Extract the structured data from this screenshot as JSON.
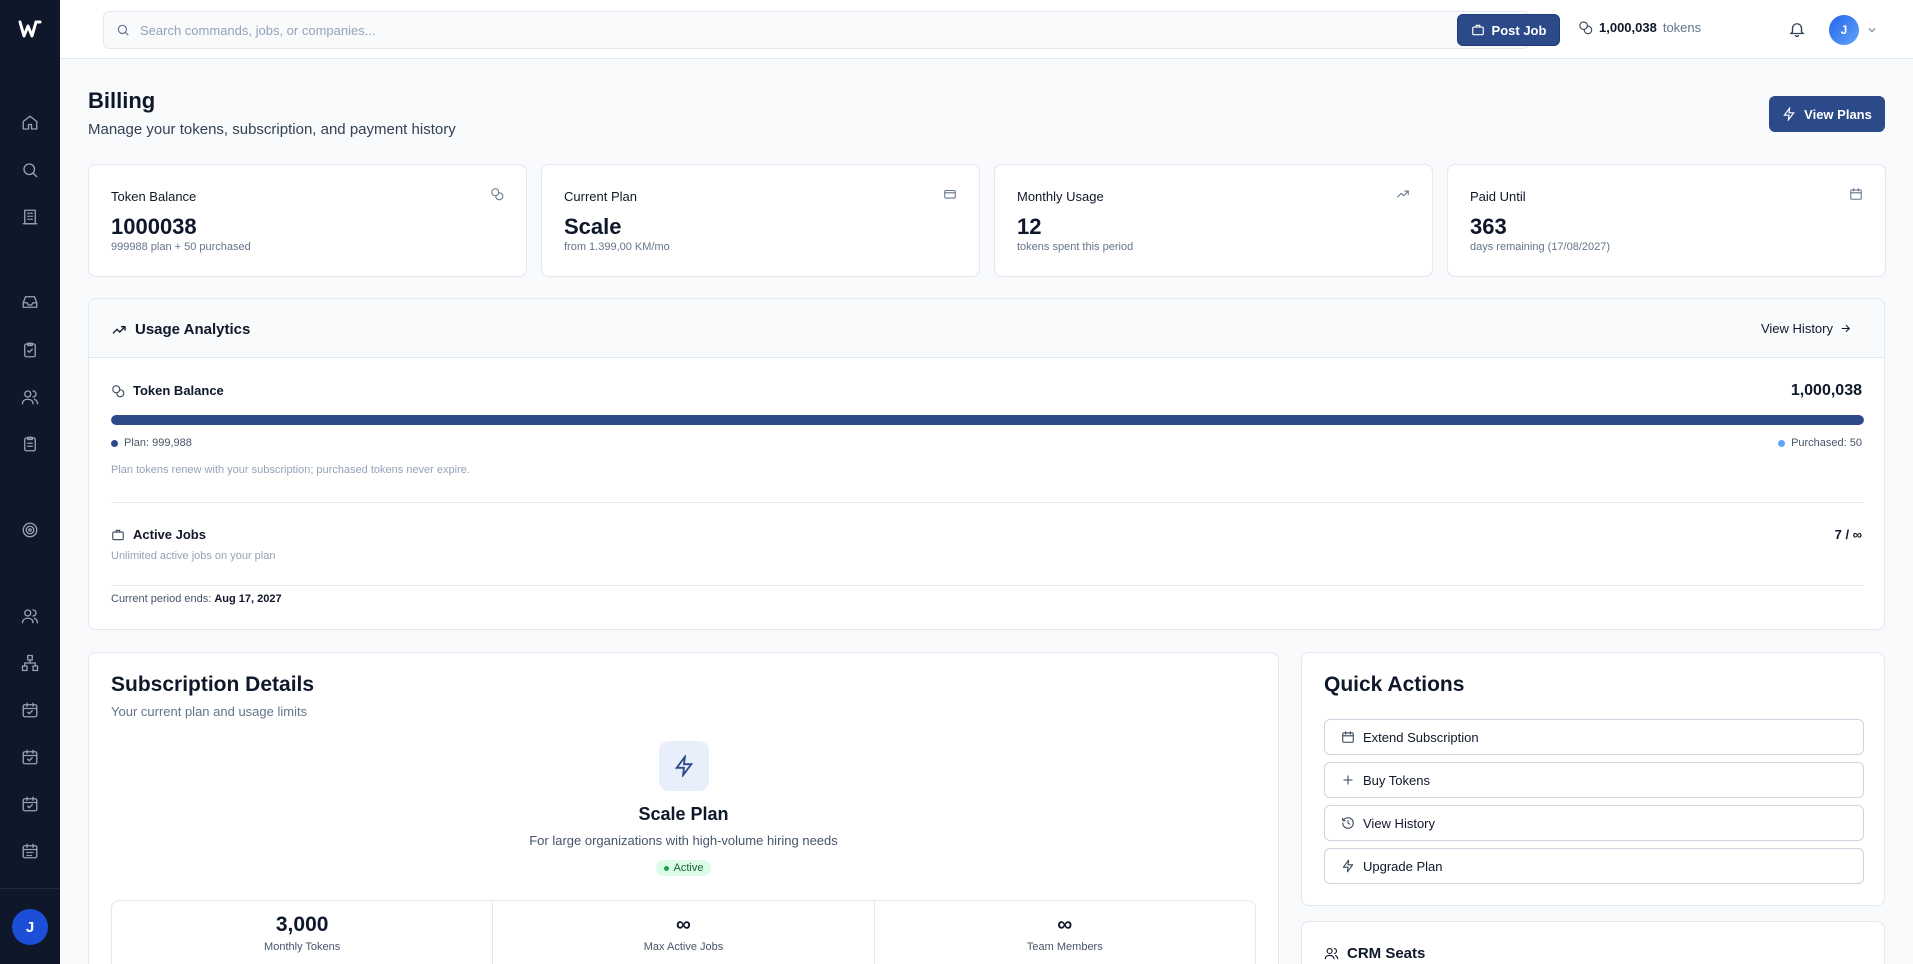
{
  "topbar": {
    "search_placeholder": "Search commands, jobs, or companies...",
    "post_job_label": "Post Job",
    "token_count": "1,000,038",
    "token_unit": "tokens",
    "avatar_initial": "J"
  },
  "sidebar": {
    "avatar_initial": "J",
    "icons": [
      "home-icon",
      "search-icon",
      "building-icon",
      "inbox-icon",
      "clipboard-check-icon",
      "users-icon",
      "clipboard-list-icon",
      "target-icon",
      "users-icon",
      "network-icon",
      "calendar-icon",
      "calendar-check-icon",
      "calendar-check-icon",
      "calendar-icon"
    ]
  },
  "header": {
    "title": "Billing",
    "subtitle": "Manage your tokens, subscription, and payment history",
    "view_plans_label": "View Plans"
  },
  "stats": [
    {
      "label": "Token Balance",
      "value": "1000038",
      "sub": "999988 plan + 50 purchased",
      "icon": "coins-icon"
    },
    {
      "label": "Current Plan",
      "value": "Scale",
      "sub": "from 1.399,00 KM/mo",
      "icon": "credit-card-icon"
    },
    {
      "label": "Monthly Usage",
      "value": "12",
      "sub": "tokens spent this period",
      "icon": "trending-up-icon"
    },
    {
      "label": "Paid Until",
      "value": "363",
      "sub": "days remaining (17/08/2027)",
      "icon": "calendar-icon"
    }
  ],
  "usage": {
    "title": "Usage Analytics",
    "view_history_label": "View History",
    "token_label": "Token Balance",
    "token_total": "1,000,038",
    "plan_fraction": 0.99995,
    "plan_legend": "Plan: 999,988",
    "purchased_legend": "Purchased: 50",
    "token_note": "Plan tokens renew with your subscription; purchased tokens never expire.",
    "jobs_label": "Active Jobs",
    "jobs_value": "7 / ∞",
    "jobs_note": "Unlimited active jobs on your plan",
    "period_label": "Current period ends:",
    "period_date": "Aug 17, 2027"
  },
  "subscription": {
    "title": "Subscription Details",
    "subtitle": "Your current plan and usage limits",
    "plan_name": "Scale Plan",
    "plan_desc": "For large organizations with high-volume hiring needs",
    "status": "Active",
    "limits": [
      {
        "value": "3,000",
        "label": "Monthly Tokens"
      },
      {
        "value": "∞",
        "label": "Max Active Jobs"
      },
      {
        "value": "∞",
        "label": "Team Members"
      }
    ]
  },
  "quick_actions": {
    "title": "Quick Actions",
    "items": [
      {
        "label": "Extend Subscription",
        "icon": "calendar-icon"
      },
      {
        "label": "Buy Tokens",
        "icon": "plus-icon"
      },
      {
        "label": "View History",
        "icon": "history-icon"
      },
      {
        "label": "Upgrade Plan",
        "icon": "zap-icon"
      }
    ]
  },
  "crm": {
    "title": "CRM Seats"
  },
  "colors": {
    "sidebar": "#0f172a",
    "accent": "#2c4a8a",
    "purchased_dot": "#60a5fa",
    "active_green": "#16a34a"
  }
}
